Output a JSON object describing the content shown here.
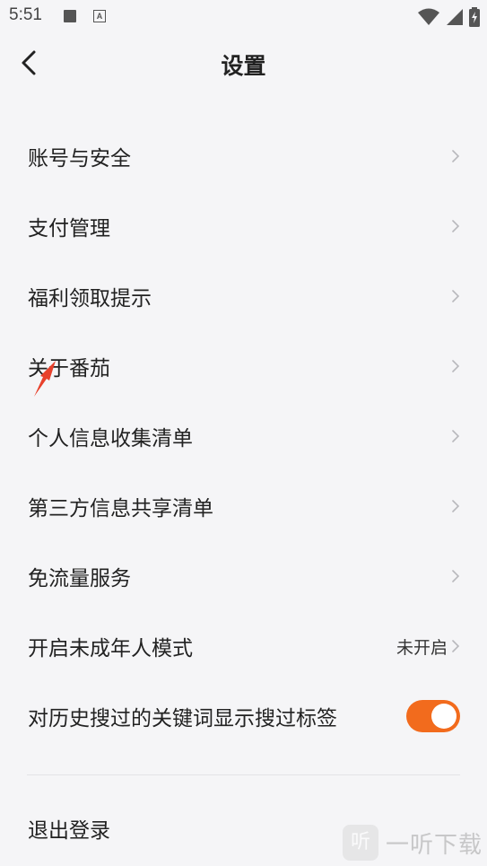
{
  "status_bar": {
    "time": "5:51",
    "a_badge": "A"
  },
  "header": {
    "title": "设置"
  },
  "menu": [
    {
      "label": "账号与安全"
    },
    {
      "label": "支付管理"
    },
    {
      "label": "福利领取提示"
    },
    {
      "label": "关于番茄"
    },
    {
      "label": "个人信息收集清单"
    },
    {
      "label": "第三方信息共享清单"
    },
    {
      "label": "免流量服务"
    },
    {
      "label": "开启未成年人模式",
      "value": "未开启"
    },
    {
      "label": "对历史搜过的关键词显示搜过标签",
      "toggle_on": true
    }
  ],
  "logout": {
    "label": "退出登录"
  },
  "watermark": {
    "logo_char": "听",
    "text": "一听下载"
  },
  "colors": {
    "background": "#f5f5f7",
    "toggle_on": "#f26b1d",
    "chevron": "#b8b8bc"
  }
}
